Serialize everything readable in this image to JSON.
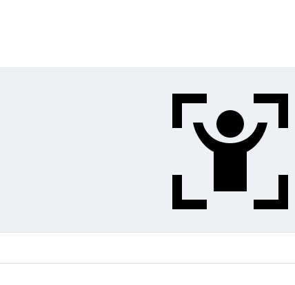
{
  "panel": {
    "background": "#edf0f5",
    "icon": {
      "name": "accessibility-scan-icon",
      "color": "#000000"
    }
  },
  "divider": {
    "color": "#d9dbe2"
  }
}
